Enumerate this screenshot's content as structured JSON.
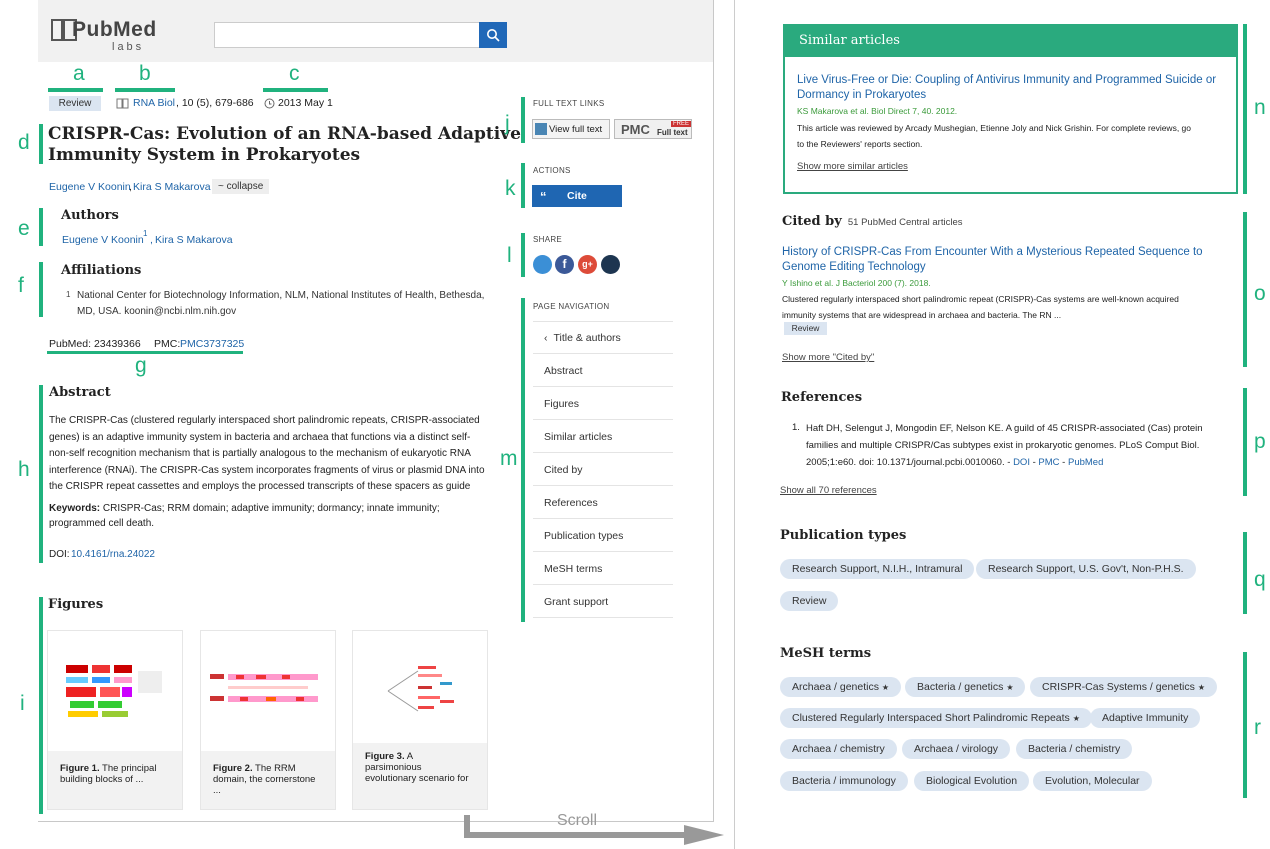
{
  "left": {
    "logo": {
      "main": "PubMed",
      "sub": "labs"
    },
    "search": {
      "placeholder": ""
    },
    "review_badge": "Review",
    "journal": {
      "name": "RNA Biol",
      "citation": ", 10 (5), 679-686"
    },
    "date": "2013 May 1",
    "title_line1": "CRISPR-Cas: Evolution of an RNA-based Adaptive",
    "title_line2": "Immunity System in Prokaryotes",
    "authors_inline": {
      "author1": "Eugene V Koonin",
      "author2": "Kira S Makarova",
      "collapse": "~ collapse"
    },
    "authors_section": {
      "title": "Authors",
      "author1": "Eugene V Koonin",
      "sup": "1",
      "sep": ",",
      "author2": "Kira S Makarova"
    },
    "affiliations": {
      "title": "Affiliations",
      "num": "1",
      "line1": "National Center for Biotechnology Information, NLM, National Institutes of Health, Bethesda,",
      "line2": "MD, USA. koonin@ncbi.nlm.nih.gov"
    },
    "ids": {
      "pubmed": "PubMed: 23439366",
      "pmc_label": "PMC:",
      "pmc": "PMC3737325"
    },
    "abstract": {
      "title": "Abstract",
      "lines": [
        "The CRISPR-Cas (clustered regularly interspaced short palindromic repeats, CRISPR-associated",
        "genes) is an adaptive immunity system in bacteria and archaea that functions via a distinct self-",
        "non-self recognition mechanism that is partially analogous to the mechanism of eukaryotic RNA",
        "interference (RNAi). The CRISPR-Cas system incorporates fragments of virus or plasmid DNA into",
        "the CRISPR repeat cassettes and employs the processed transcripts of these spacers as guide"
      ],
      "keywords_label": "Keywords:",
      "keywords_line1": " CRISPR-Cas; RRM domain; adaptive immunity; dormancy; innate immunity;",
      "keywords_line2": "programmed cell death.",
      "doi_label": "DOI: ",
      "doi": "10.4161/rna.24022"
    },
    "figures": {
      "title": "Figures",
      "items": [
        {
          "bold": "Figure 1.",
          "rest": " The principal",
          "line2": "building blocks of ..."
        },
        {
          "bold": "Figure 2.",
          "rest": " The RRM",
          "line2": "domain, the cornerstone",
          "line3": "..."
        },
        {
          "bold": "Figure 3.",
          "rest": " A",
          "line2": "parsimonious",
          "line3": "evolutionary scenario for"
        }
      ]
    },
    "sidebar": {
      "full_text_label": "FULL TEXT LINKS",
      "view_full_text": "View full text",
      "pmc_logo": "PMC",
      "pmc_free": "FREE",
      "pmc_full": "Full text",
      "actions_label": "ACTIONS",
      "cite": "Cite",
      "cite_quote": "“",
      "share_label": "SHARE",
      "page_nav_label": "PAGE NAVIGATION",
      "nav": [
        "Title & authors",
        "Abstract",
        "Figures",
        "Similar articles",
        "Cited by",
        "References",
        "Publication types",
        "MeSH terms",
        "Grant support"
      ]
    },
    "scroll": "Scroll"
  },
  "labels": {
    "a": "a",
    "b": "b",
    "c": "c",
    "d": "d",
    "e": "e",
    "f": "f",
    "g": "g",
    "h": "h",
    "i": "i",
    "j": "j",
    "k": "k",
    "l": "l",
    "m": "m",
    "n": "n",
    "o": "o",
    "p": "p",
    "q": "q",
    "r": "r"
  },
  "right": {
    "similar": {
      "header": "Similar articles",
      "title_line1": "Live Virus-Free or Die: Coupling of Antivirus Immunity and Programmed Suicide or",
      "title_line2": "Dormancy in Prokaryotes",
      "cite": "KS Makarova et al. Biol Direct 7, 40. 2012.",
      "desc_line1": "This article was reviewed by Arcady Mushegian, Etienne Joly and Nick Grishin. For complete reviews, go",
      "desc_line2": "to the Reviewers' reports section.",
      "more": "Show more similar articles"
    },
    "cited": {
      "title": "Cited by",
      "count": "51 PubMed Central articles",
      "article_line1": "History of CRISPR-Cas From Encounter With a Mysterious Repeated Sequence to",
      "article_line2": "Genome Editing Technology",
      "cite": "Y Ishino et al. J Bacteriol 200 (7). 2018.",
      "desc_line1": "Clustered regularly interspaced short palindromic repeat (CRISPR)-Cas systems are well-known acquired",
      "desc_line2": "immunity systems that are widespread in archaea and bacteria. The RN ...",
      "badge": "Review",
      "more": "Show more \"Cited by\""
    },
    "references": {
      "title": "References",
      "num": "1.",
      "line1": "Haft DH, Selengut J, Mongodin EF, Nelson KE. A guild of 45 CRISPR-associated (Cas) protein",
      "line2": "families and multiple CRISPR/Cas subtypes exist in prokaryotic genomes. PLoS Comput Biol.",
      "line3": "2005;1:e60. doi: 10.1371/journal.pcbi.0010060. - ",
      "doi": "DOI",
      "dash": " - ",
      "pmc": "PMC",
      "pubmed": "PubMed",
      "more": "Show all 70 references"
    },
    "pubtypes": {
      "title": "Publication types",
      "items": [
        "Research Support, N.I.H., Intramural",
        "Research Support, U.S. Gov't, Non-P.H.S.",
        "Review"
      ]
    },
    "mesh": {
      "title": "MeSH terms",
      "star": "★",
      "items": [
        "Archaea / genetics",
        "Bacteria / genetics",
        "CRISPR-Cas Systems / genetics",
        "Clustered Regularly Interspaced Short Palindromic Repeats",
        "Adaptive Immunity",
        "Archaea / chemistry",
        "Archaea / virology",
        "Bacteria / chemistry",
        "Bacteria / immunology",
        "Biological Evolution",
        "Evolution, Molecular"
      ]
    }
  },
  "colors": {
    "accent": "#20b27e",
    "link": "#2065a8",
    "cite_button": "#1f66b2",
    "pill": "#dbe5f1"
  }
}
